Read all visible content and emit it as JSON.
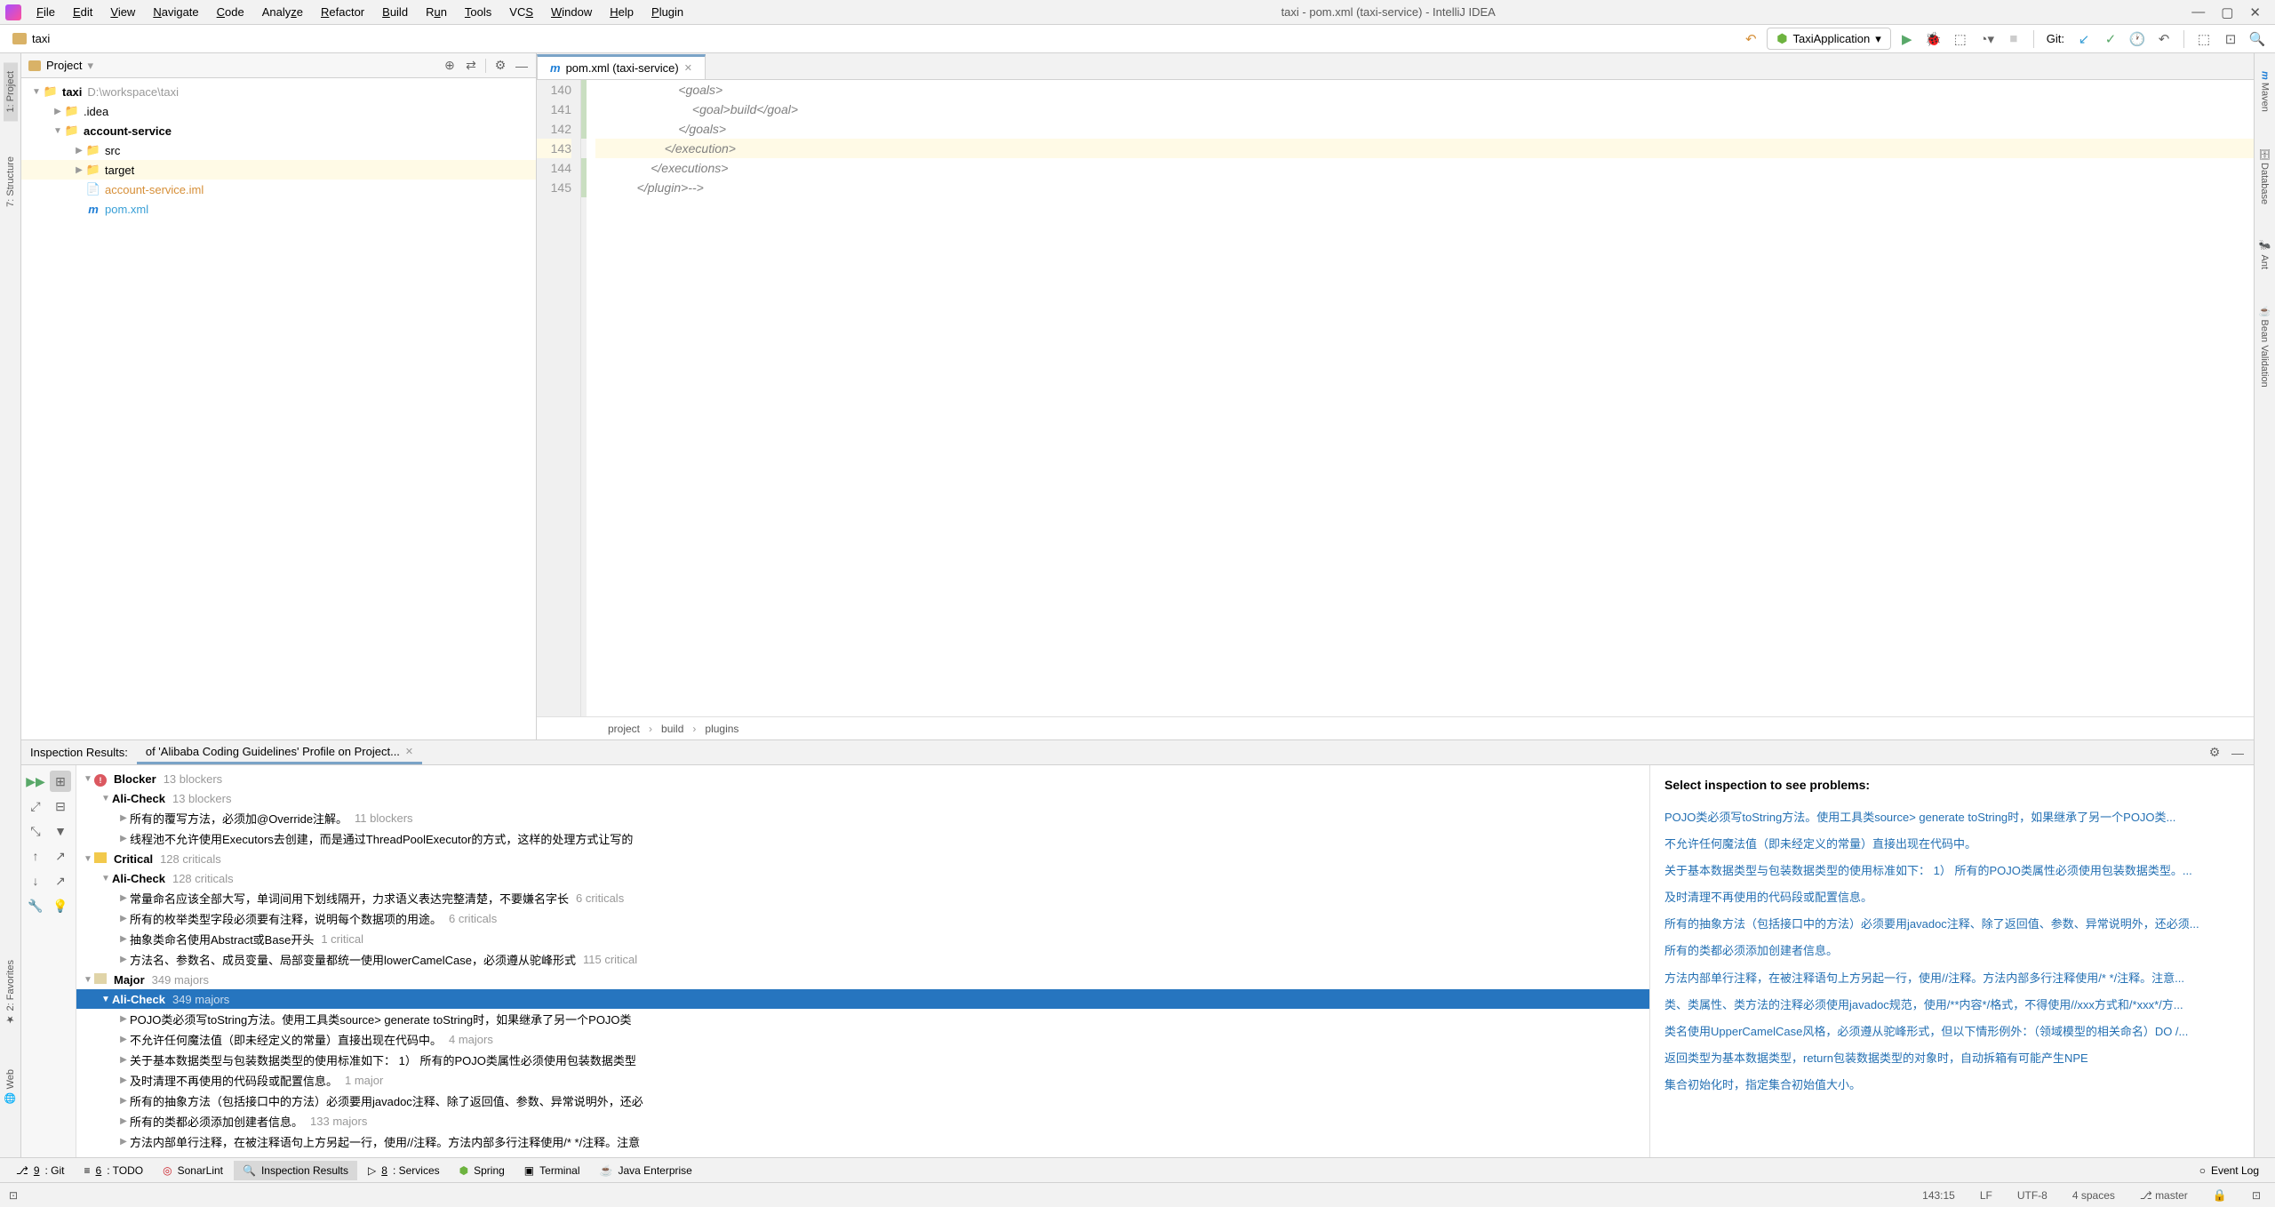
{
  "window": {
    "title": "taxi - pom.xml (taxi-service) - IntelliJ IDEA"
  },
  "menu": {
    "file": "File",
    "edit": "Edit",
    "view": "View",
    "navigate": "Navigate",
    "code": "Code",
    "analyze": "Analyze",
    "refactor": "Refactor",
    "build": "Build",
    "run": "Run",
    "tools": "Tools",
    "vcs": "VCS",
    "window": "Window",
    "help": "Help",
    "plugin": "Plugin"
  },
  "toolbar": {
    "project_name": "taxi",
    "run_config": "TaxiApplication",
    "git_label": "Git:"
  },
  "project": {
    "header": "Project",
    "root": {
      "name": "taxi",
      "path": "D:\\workspace\\taxi"
    },
    "nodes": {
      "idea": ".idea",
      "account_service": "account-service",
      "src": "src",
      "target": "target",
      "iml": "account-service.iml",
      "pom": "pom.xml"
    }
  },
  "editor": {
    "tab_name": "pom.xml (taxi-service)",
    "lines": [
      {
        "num": "140",
        "text": "                        <goals>"
      },
      {
        "num": "141",
        "text": "                            <goal>build</goal>"
      },
      {
        "num": "142",
        "text": "                        </goals>"
      },
      {
        "num": "143",
        "text": "                    </execution>"
      },
      {
        "num": "144",
        "text": "                </executions>"
      },
      {
        "num": "145",
        "text": "            </plugin>-->"
      }
    ],
    "breadcrumb": {
      "p1": "project",
      "p2": "build",
      "p3": "plugins"
    }
  },
  "inspection": {
    "header": "Inspection Results:",
    "tab": "of 'Alibaba Coding Guidelines' Profile on Project...",
    "tree": {
      "blocker": {
        "label": "Blocker",
        "count": "13 blockers"
      },
      "blocker_ali": {
        "label": "Ali-Check",
        "count": "13 blockers"
      },
      "blocker_i1": {
        "label": "所有的覆写方法，必须加@Override注解。",
        "count": "11 blockers"
      },
      "blocker_i2": {
        "label": "线程池不允许使用Executors去创建，而是通过ThreadPoolExecutor的方式，这样的处理方式让写的"
      },
      "critical": {
        "label": "Critical",
        "count": "128 criticals"
      },
      "critical_ali": {
        "label": "Ali-Check",
        "count": "128 criticals"
      },
      "critical_i1": {
        "label": "常量命名应该全部大写，单词间用下划线隔开，力求语义表达完整清楚，不要嫌名字长",
        "count": "6 criticals"
      },
      "critical_i2": {
        "label": "所有的枚举类型字段必须要有注释，说明每个数据项的用途。",
        "count": "6 criticals"
      },
      "critical_i3": {
        "label": "抽象类命名使用Abstract或Base开头",
        "count": "1 critical"
      },
      "critical_i4": {
        "label": "方法名、参数名、成员变量、局部变量都统一使用lowerCamelCase，必须遵从驼峰形式",
        "count": "115 critical"
      },
      "major": {
        "label": "Major",
        "count": "349 majors"
      },
      "major_ali": {
        "label": "Ali-Check",
        "count": "349 majors"
      },
      "major_i1": {
        "label": "POJO类必须写toString方法。使用工具类source> generate toString时，如果继承了另一个POJO类"
      },
      "major_i2": {
        "label": "不允许任何魔法值（即未经定义的常量）直接出现在代码中。",
        "count": "4 majors"
      },
      "major_i3": {
        "label": "关于基本数据类型与包装数据类型的使用标准如下：   1） 所有的POJO类属性必须使用包装数据类型"
      },
      "major_i4": {
        "label": "及时清理不再使用的代码段或配置信息。",
        "count": "1 major"
      },
      "major_i5": {
        "label": "所有的抽象方法（包括接口中的方法）必须要用javadoc注释、除了返回值、参数、异常说明外，还必"
      },
      "major_i6": {
        "label": "所有的类都必须添加创建者信息。",
        "count": "133 majors"
      },
      "major_i7": {
        "label": "方法内部单行注释，在被注释语句上方另起一行，使用//注释。方法内部多行注释使用/* */注释。注意"
      }
    },
    "detail": {
      "title": "Select inspection to see problems:",
      "links": [
        "POJO类必须写toString方法。使用工具类source> generate toString时，如果继承了另一个POJO类...",
        "不允许任何魔法值（即未经定义的常量）直接出现在代码中。",
        "关于基本数据类型与包装数据类型的使用标准如下：   1） 所有的POJO类属性必须使用包装数据类型。...",
        "及时清理不再使用的代码段或配置信息。",
        "所有的抽象方法（包括接口中的方法）必须要用javadoc注释、除了返回值、参数、异常说明外，还必须...",
        "所有的类都必须添加创建者信息。",
        "方法内部单行注释，在被注释语句上方另起一行，使用//注释。方法内部多行注释使用/* */注释。注意...",
        "类、类属性、类方法的注释必须使用javadoc规范，使用/**内容*/格式，不得使用//xxx方式和/*xxx*/方...",
        "类名使用UpperCamelCase风格，必须遵从驼峰形式，但以下情形例外：（领域模型的相关命名）DO /...",
        "返回类型为基本数据类型，return包装数据类型的对象时，自动拆箱有可能产生NPE",
        "集合初始化时，指定集合初始值大小。"
      ]
    }
  },
  "left_tabs": {
    "project": "1: Project",
    "structure": "7: Structure",
    "favorites": "2: Favorites",
    "web": "Web"
  },
  "right_tabs": {
    "maven": "Maven",
    "database": "Database",
    "ant": "Ant",
    "bean": "Bean Validation"
  },
  "bottom": {
    "git": "9: Git",
    "todo": "6: TODO",
    "sonar": "SonarLint",
    "inspection": "Inspection Results",
    "services": "8: Services",
    "spring": "Spring",
    "terminal": "Terminal",
    "java_ee": "Java Enterprise",
    "event_log": "Event Log"
  },
  "status": {
    "pos": "143:15",
    "lf": "LF",
    "encoding": "UTF-8",
    "indent": "4 spaces",
    "branch": "master"
  }
}
